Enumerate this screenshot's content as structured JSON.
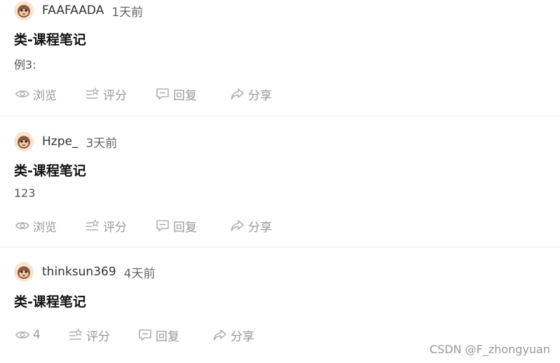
{
  "posts": [
    {
      "username": "FAAFAADA",
      "time": "1天前",
      "title": "类-课程笔记",
      "excerpt": "例3:",
      "view": "浏览",
      "rate": "评分",
      "reply": "回复",
      "share": "分享"
    },
    {
      "username": "Hzpe_",
      "time": "3天前",
      "title": "类-课程笔记",
      "excerpt": "123",
      "view": "浏览",
      "rate": "评分",
      "reply": "回复",
      "share": "分享"
    },
    {
      "username": "thinksun369",
      "time": "4天前",
      "title": "类-课程笔记",
      "excerpt": "",
      "view": "4",
      "rate": "评分",
      "reply": "回复",
      "share": "分享"
    }
  ],
  "watermark": "CSDN @F_zhongyuan",
  "icons": {
    "view": "eye-icon",
    "rate": "rate-icon",
    "reply": "comment-icon",
    "share": "share-icon",
    "avatar": "monkey-avatar"
  },
  "colors": {
    "icon": "#b0b0b0",
    "text_muted": "#999999",
    "avatar_bg": "#fbe3d0"
  }
}
